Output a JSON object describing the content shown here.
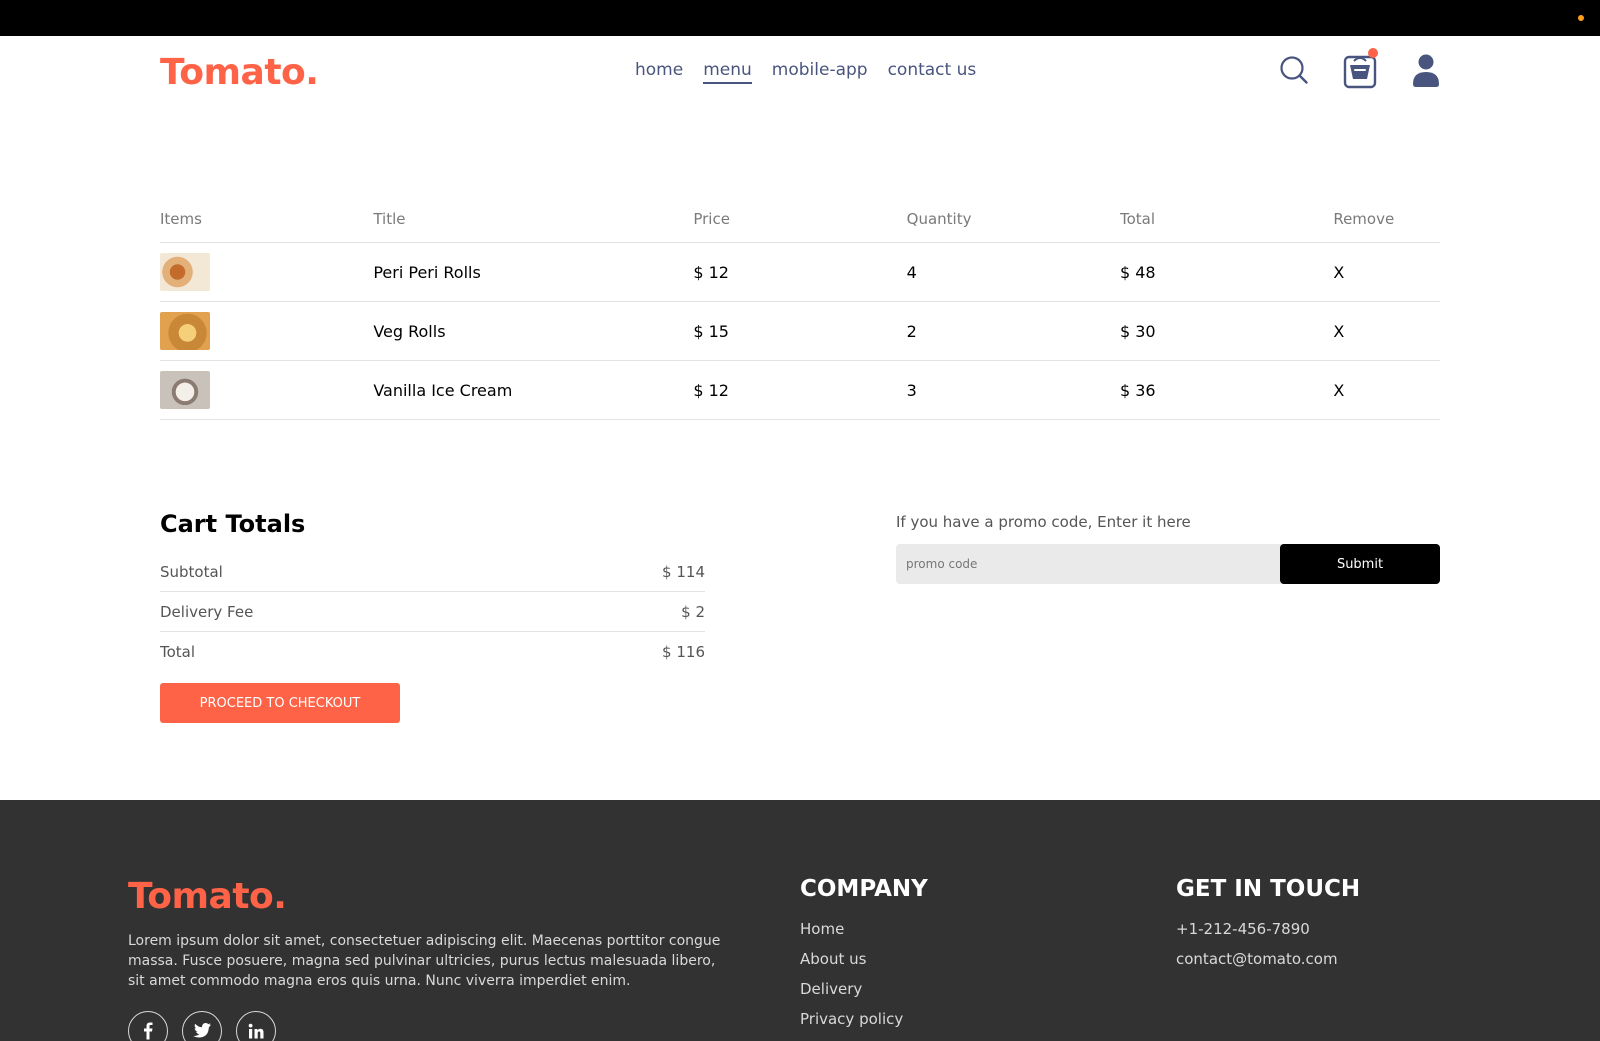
{
  "brand": {
    "logo": "Tomato.",
    "accent_color": "#ff6347"
  },
  "nav": {
    "links": [
      "home",
      "menu",
      "mobile-app",
      "contact us"
    ],
    "active": "menu",
    "icons": [
      "search-icon",
      "basket-icon",
      "profile-icon"
    ]
  },
  "cart": {
    "headers": [
      "Items",
      "Title",
      "Price",
      "Quantity",
      "Total",
      "Remove"
    ],
    "rows": [
      {
        "title": "Peri Peri Rolls",
        "price": "$ 12",
        "quantity": "4",
        "total": "$ 48",
        "remove": "X"
      },
      {
        "title": "Veg Rolls",
        "price": "$ 15",
        "quantity": "2",
        "total": "$ 30",
        "remove": "X"
      },
      {
        "title": "Vanilla Ice Cream",
        "price": "$ 12",
        "quantity": "3",
        "total": "$ 36",
        "remove": "X"
      }
    ]
  },
  "totals": {
    "title": "Cart Totals",
    "subtotal_label": "Subtotal",
    "subtotal_value": "$ 114",
    "delivery_label": "Delivery Fee",
    "delivery_value": "$ 2",
    "total_label": "Total",
    "total_value": "$ 116",
    "checkout_label": "PROCEED TO CHECKOUT"
  },
  "promo": {
    "label": "If you have a promo code, Enter it here",
    "placeholder": "promo code",
    "submit_label": "Submit"
  },
  "footer": {
    "logo": "Tomato.",
    "description": "Lorem ipsum dolor sit amet, consectetuer adipiscing elit. Maecenas porttitor congue massa. Fusce posuere, magna sed pulvinar ultricies, purus lectus malesuada libero, sit amet commodo magna eros quis urna. Nunc viverra imperdiet enim.",
    "socials": [
      "facebook-icon",
      "twitter-icon",
      "linkedin-icon"
    ],
    "company": {
      "title": "COMPANY",
      "links": [
        "Home",
        "About us",
        "Delivery",
        "Privacy policy"
      ]
    },
    "contact": {
      "title": "GET IN TOUCH",
      "phone": "+1-212-456-7890",
      "email": "contact@tomato.com"
    }
  }
}
